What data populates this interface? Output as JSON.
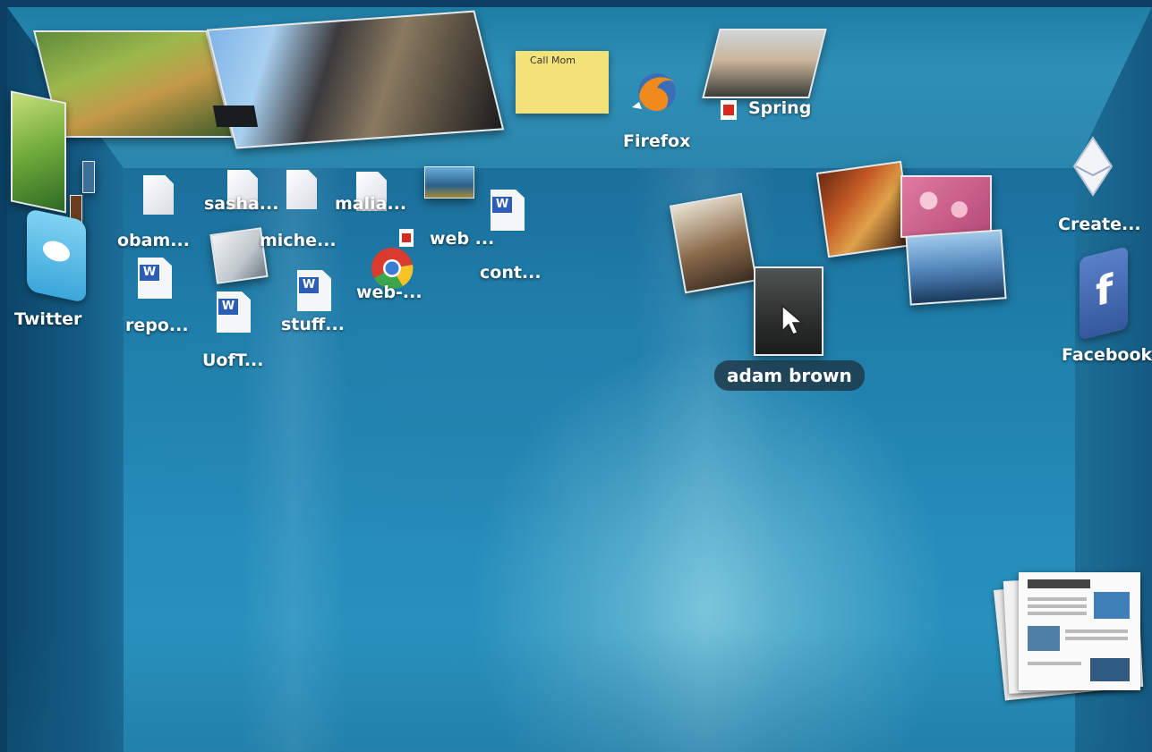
{
  "ceiling": {
    "sticky_note": "Call Mom",
    "firefox_label": "Firefox",
    "spring_label": "Spring"
  },
  "left_wall": {
    "twitter_label": "Twitter"
  },
  "right_wall": {
    "create_label": "Create...",
    "facebook_label": "Facebook"
  },
  "desktop_items": {
    "obam": "obam...",
    "sasha": "sasha...",
    "miche": "miche...",
    "malia": "malia...",
    "web1": "web ...",
    "cont": "cont...",
    "web2": "web-...",
    "repo": "repo...",
    "stuff": "stuff...",
    "uoft": "UofT..."
  },
  "hover_label": "adam brown",
  "icons": {
    "firefox": "firefox-icon",
    "chrome": "chrome-icon",
    "twitter": "twitter-bird-icon",
    "facebook": "facebook-icon",
    "create": "envelope-create-icon",
    "pdf": "pdf-icon",
    "cursor": "mouse-cursor-icon"
  }
}
